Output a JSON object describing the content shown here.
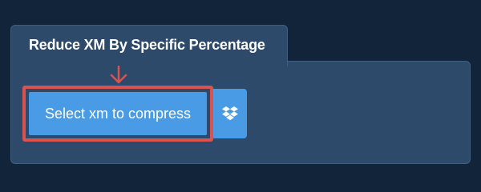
{
  "tool": {
    "tab_title": "Reduce XM By Specific Percentage",
    "select_button_label": "Select xm to compress"
  },
  "icons": {
    "pointer": "arrow-down-icon",
    "cloud": "dropbox-icon"
  },
  "colors": {
    "page_background": "#12243a",
    "panel_background": "#2d4a6a",
    "button_blue": "#4a9be6",
    "highlight_red": "#d9534f"
  }
}
